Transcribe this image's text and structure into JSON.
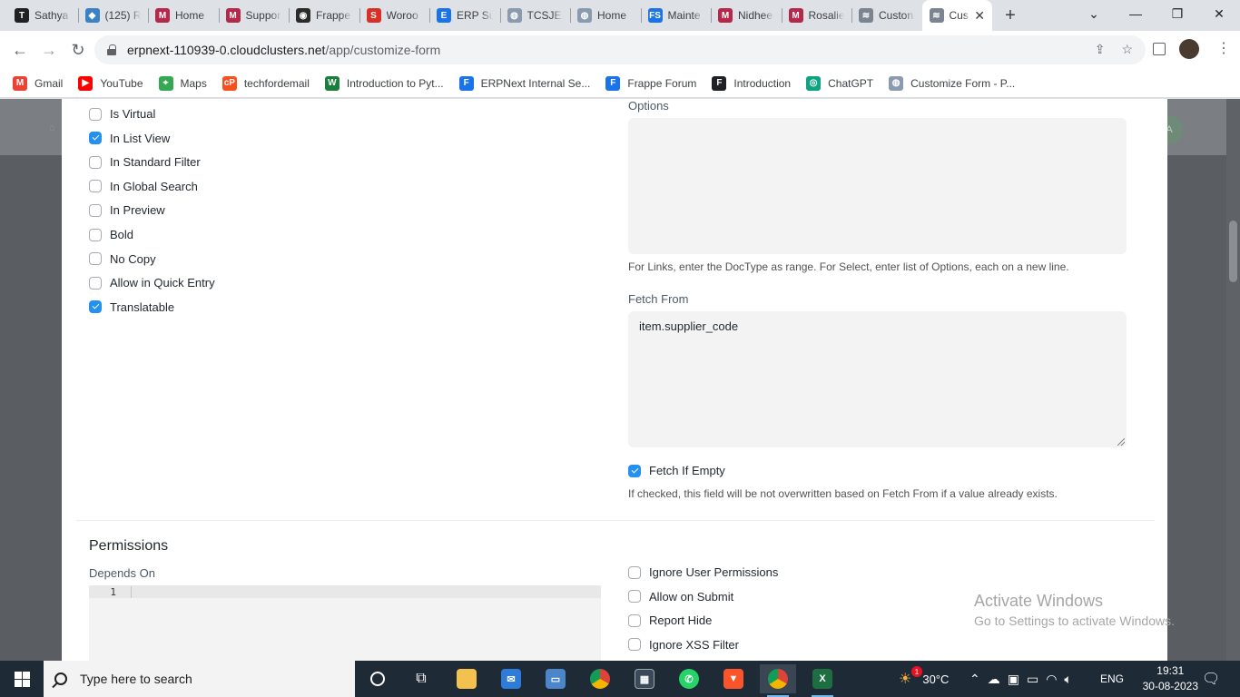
{
  "browser": {
    "tabs": [
      {
        "title": "Sathya",
        "icon": "T",
        "color": "#202124"
      },
      {
        "title": "(125) R",
        "icon": "◆",
        "color": "#3b82c4"
      },
      {
        "title": "Home",
        "icon": "M",
        "color": "#b5284a"
      },
      {
        "title": "Suppor",
        "icon": "M",
        "color": "#b5284a"
      },
      {
        "title": "Frappe",
        "icon": "◉",
        "color": "#2b2b2b"
      },
      {
        "title": "Woroo",
        "icon": "S",
        "color": "#d93025"
      },
      {
        "title": "ERP Su",
        "icon": "E",
        "color": "#1a73e8"
      },
      {
        "title": "TCSJEA",
        "icon": "◍",
        "color": "#8a9bb0"
      },
      {
        "title": "Home",
        "icon": "◍",
        "color": "#8a9bb0"
      },
      {
        "title": "Mainte",
        "icon": "FS",
        "color": "#1a73e8"
      },
      {
        "title": "Nidhee",
        "icon": "M",
        "color": "#b5284a"
      },
      {
        "title": "Rosalie",
        "icon": "M",
        "color": "#b5284a"
      },
      {
        "title": "Custon",
        "icon": "≋",
        "color": "#7a8591"
      },
      {
        "title": "Cus",
        "icon": "≋",
        "color": "#7a8591",
        "active": true
      }
    ],
    "new_tab": "+",
    "url_host": "erpnext-110939-0.cloudclusters.net",
    "url_path": "/app/customize-form",
    "bookmarks": [
      {
        "label": "Gmail",
        "icon": "M",
        "color": "#ea4335"
      },
      {
        "label": "YouTube",
        "icon": "▶",
        "color": "#ff0000"
      },
      {
        "label": "Maps",
        "icon": "⌖",
        "color": "#34a853"
      },
      {
        "label": "techfordemail",
        "icon": "cP",
        "color": "#f4511e"
      },
      {
        "label": "Introduction to Pyt...",
        "icon": "W",
        "color": "#1b7f3b"
      },
      {
        "label": "ERPNext Internal Se...",
        "icon": "F",
        "color": "#1a73e8"
      },
      {
        "label": "Frappe Forum",
        "icon": "F",
        "color": "#1a73e8"
      },
      {
        "label": "Introduction",
        "icon": "F",
        "color": "#202124"
      },
      {
        "label": "ChatGPT",
        "icon": "◎",
        "color": "#10a37f"
      },
      {
        "label": "Customize Form - P...",
        "icon": "◍",
        "color": "#8a9bb0"
      }
    ]
  },
  "form": {
    "left_checkboxes": [
      {
        "label": "Is Virtual",
        "checked": false
      },
      {
        "label": "In List View",
        "checked": true
      },
      {
        "label": "In Standard Filter",
        "checked": false
      },
      {
        "label": "In Global Search",
        "checked": false
      },
      {
        "label": "In Preview",
        "checked": false
      },
      {
        "label": "Bold",
        "checked": false
      },
      {
        "label": "No Copy",
        "checked": false
      },
      {
        "label": "Allow in Quick Entry",
        "checked": false
      },
      {
        "label": "Translatable",
        "checked": true
      }
    ],
    "options_label": "Options",
    "options_value": "",
    "options_help": "For Links, enter the DocType as range. For Select, enter list of Options, each on a new line.",
    "fetch_from_label": "Fetch From",
    "fetch_from_value": "item.supplier_code",
    "fetch_if_empty_label": "Fetch If Empty",
    "fetch_if_empty_checked": true,
    "fetch_if_empty_help": "If checked, this field will be not overwritten based on Fetch From if a value already exists.",
    "permissions_title": "Permissions",
    "depends_on_label": "Depends On",
    "depends_on_line": "1",
    "permission_checkboxes": [
      {
        "label": "Ignore User Permissions",
        "checked": false
      },
      {
        "label": "Allow on Submit",
        "checked": false
      },
      {
        "label": "Report Hide",
        "checked": false
      },
      {
        "label": "Ignore XSS Filter",
        "checked": false
      }
    ]
  },
  "watermark": {
    "line1": "Activate Windows",
    "line2": "Go to Settings to activate Windows."
  },
  "background": {
    "badge": "A"
  },
  "taskbar": {
    "search_placeholder": "Type here to search",
    "weather": "30°C",
    "language": "ENG",
    "time": "19:31",
    "date": "30-08-2023",
    "notification_count": "1"
  },
  "colors": {
    "accent": "#2490ef",
    "taskbar": "#1f2a37"
  }
}
